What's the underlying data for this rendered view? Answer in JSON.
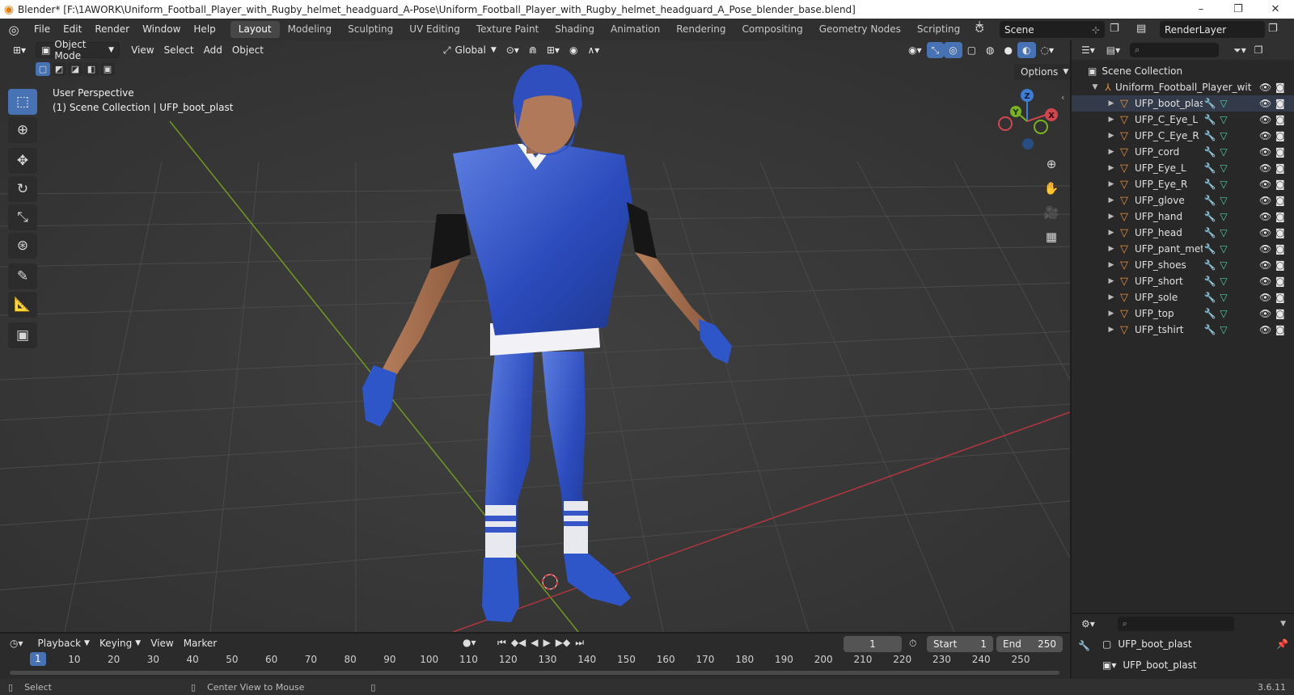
{
  "titlebar": {
    "title": "Blender* [F:\\1AWORK\\Uniform_Football_Player_with_Rugby_helmet_headguard_A-Pose\\Uniform_Football_Player_with_Rugby_helmet_headguard_A_Pose_blender_base.blend]",
    "minimize": "–",
    "maximize": "❐",
    "close": "✕"
  },
  "menu": [
    "File",
    "Edit",
    "Render",
    "Window",
    "Help"
  ],
  "workspaces": [
    "Layout",
    "Modeling",
    "Sculpting",
    "UV Editing",
    "Texture Paint",
    "Shading",
    "Animation",
    "Rendering",
    "Compositing",
    "Geometry Nodes",
    "Scripting"
  ],
  "active_workspace": "Layout",
  "scene_name": "Scene",
  "view_layer": "RenderLayer",
  "viewport": {
    "mode": "Object Mode",
    "menus": [
      "View",
      "Select",
      "Add",
      "Object"
    ],
    "transform_orientation": "Global",
    "options_label": "Options",
    "perspective_label": "User Perspective",
    "collection_label": "(1) Scene Collection | UFP_boot_plast",
    "axis_x": "X",
    "axis_y": "Y",
    "axis_z": "Z"
  },
  "outliner": {
    "root": "Scene Collection",
    "parent": "Uniform_Football_Player_wit",
    "objects": [
      "UFP_boot_plast",
      "UFP_C_Eye_L",
      "UFP_C_Eye_R",
      "UFP_cord",
      "UFP_Eye_L",
      "UFP_Eye_R",
      "UFP_glove",
      "UFP_hand",
      "UFP_head",
      "UFP_pant_met",
      "UFP_shoes",
      "UFP_short",
      "UFP_sole",
      "UFP_top",
      "UFP_tshirt"
    ]
  },
  "properties": {
    "object_name": "UFP_boot_plast",
    "mesh_name": "UFP_boot_plast"
  },
  "timeline": {
    "menus": [
      "Playback",
      "Keying",
      "View",
      "Marker"
    ],
    "current_frame": "1",
    "start_label": "Start",
    "start": "1",
    "end_label": "End",
    "end": "250",
    "ticks": [
      "1",
      "10",
      "20",
      "30",
      "40",
      "50",
      "60",
      "70",
      "80",
      "90",
      "100",
      "110",
      "120",
      "130",
      "140",
      "150",
      "160",
      "170",
      "180",
      "190",
      "200",
      "210",
      "220",
      "230",
      "240",
      "250"
    ]
  },
  "statusbar": {
    "select": "Select",
    "center_view": "Center View to Mouse",
    "version": "3.6.11"
  },
  "colors": {
    "accent": "#4772b3",
    "jersey_blue": "#2f4fc0",
    "mesh_icon": "#e7923f",
    "x_axis": "#d0464f",
    "y_axis": "#7bb320",
    "z_axis": "#3c7ed6"
  }
}
